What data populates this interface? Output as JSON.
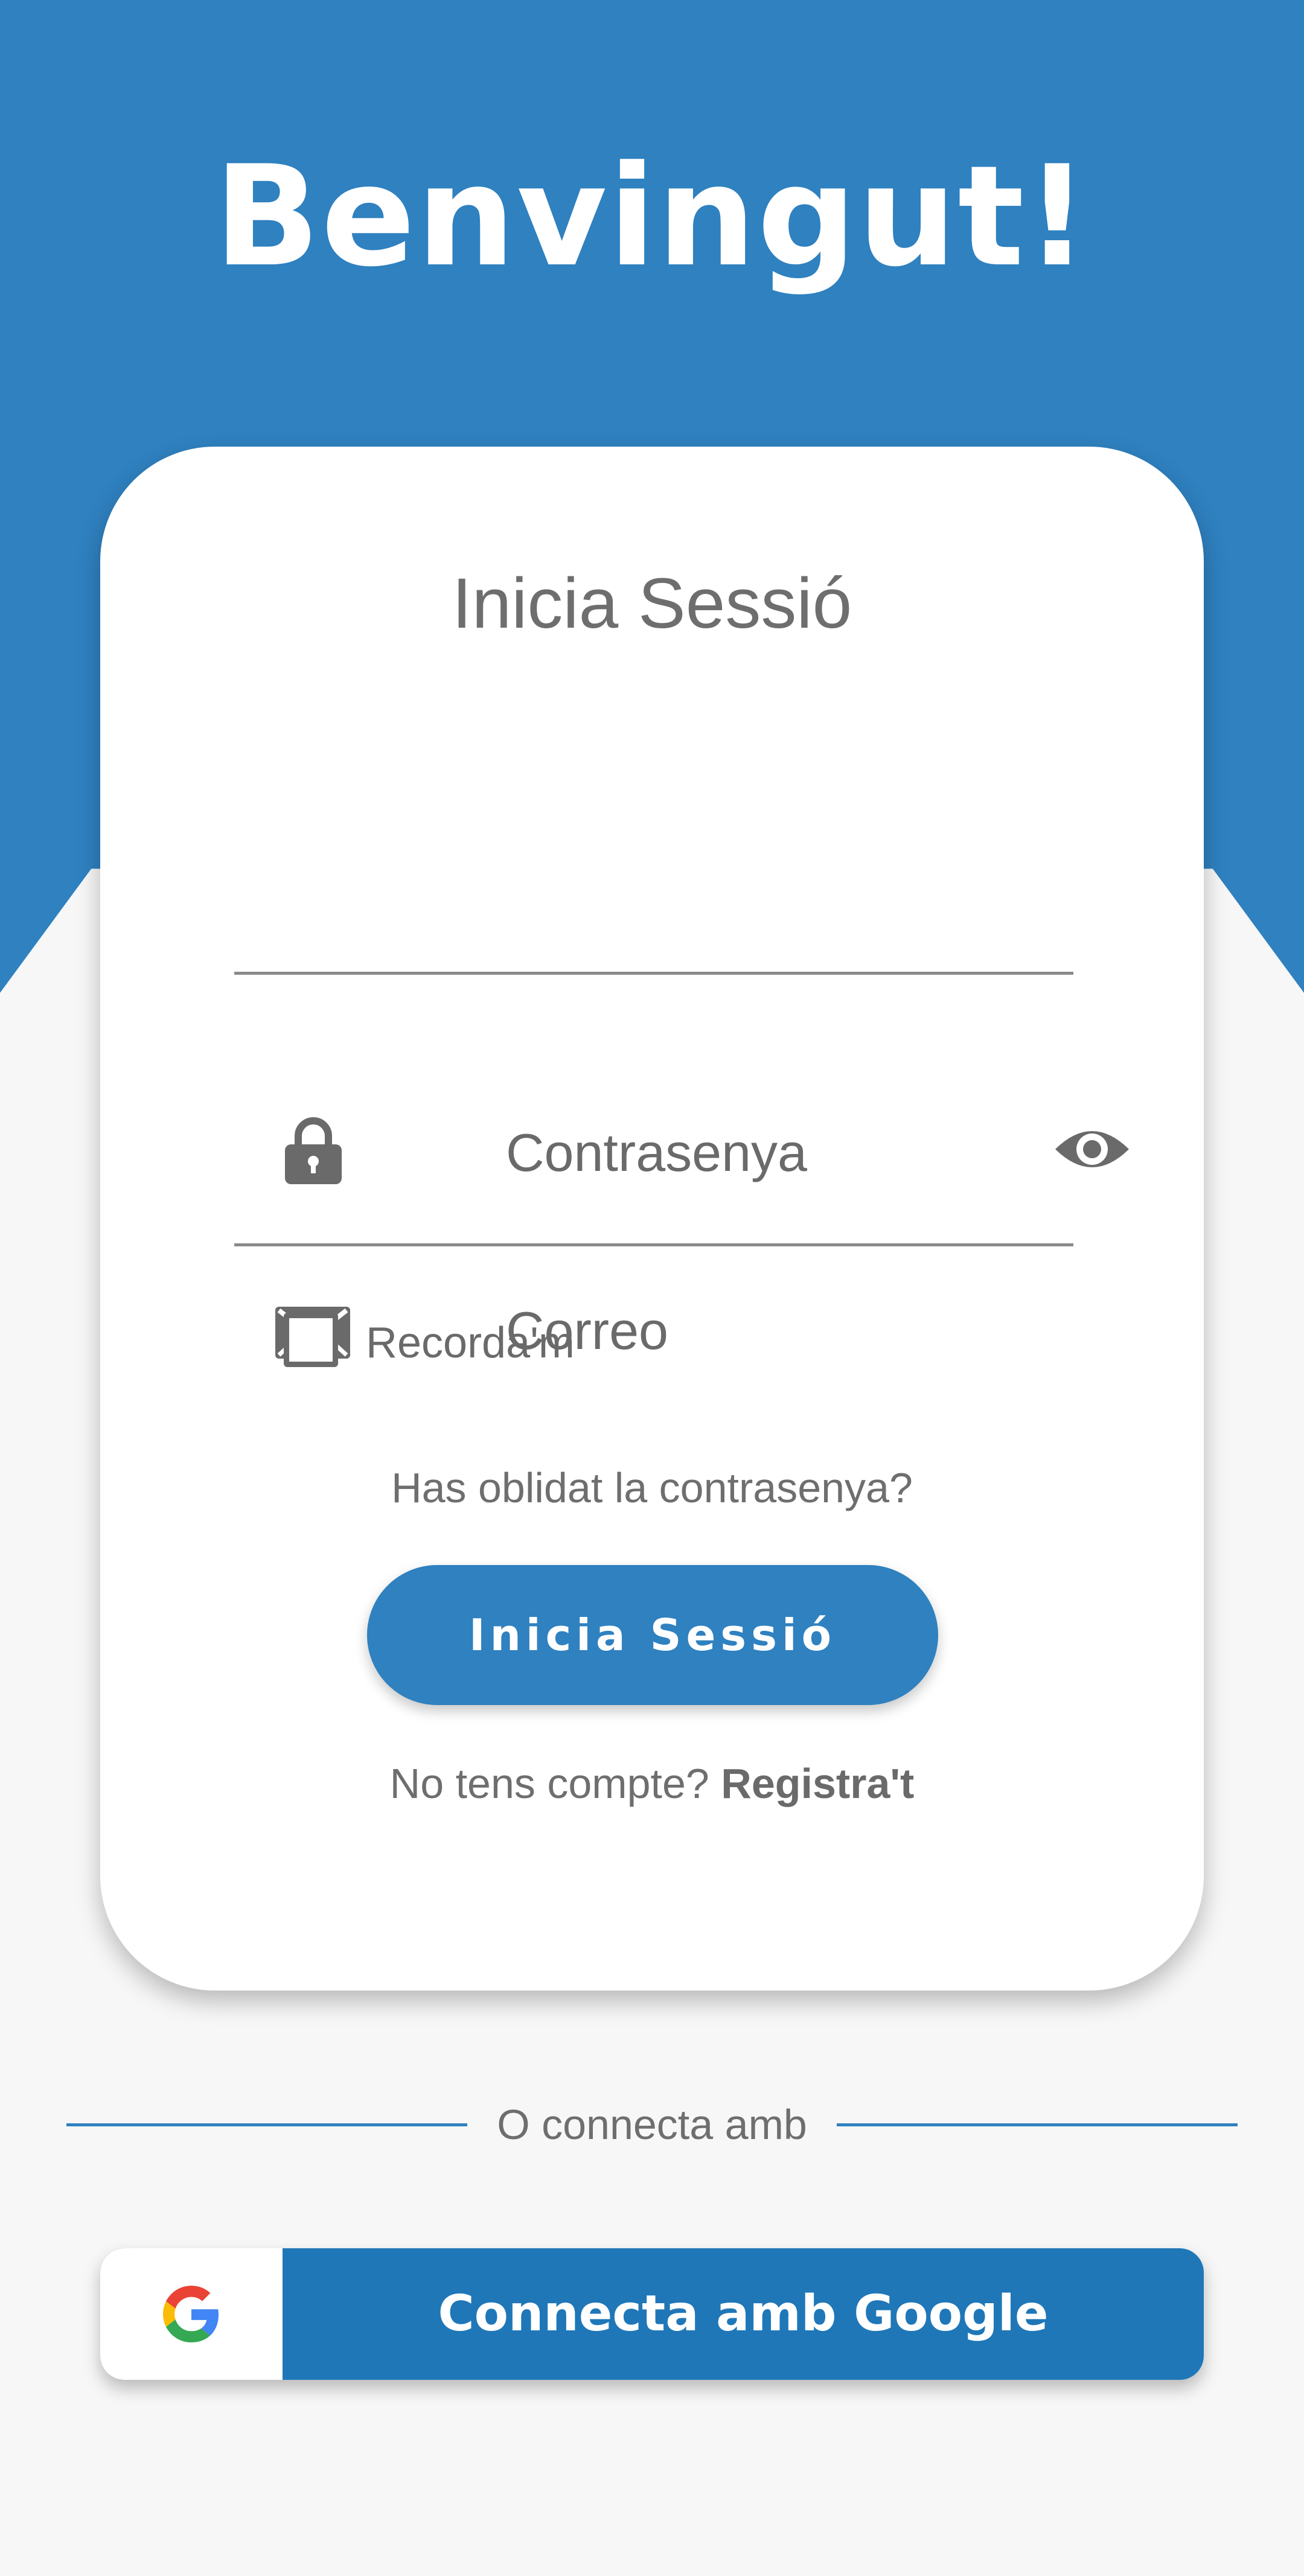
{
  "header": {
    "welcome_title": "Benvingut!"
  },
  "login_card": {
    "title": "Inicia Sessió",
    "email_field": {
      "placeholder": "Correo",
      "icon": "envelope-icon"
    },
    "password_field": {
      "placeholder": "Contrasenya",
      "icon": "lock-icon",
      "toggle_icon": "eye-icon"
    },
    "remember_me": {
      "label": "Recorda'm",
      "checked": false
    },
    "forgot_password": "Has oblidat la contrasenya?",
    "login_button": "Inicia Sessió",
    "signup_prompt": "No tens compte?",
    "signup_link": "Registra't"
  },
  "social": {
    "divider_text": "O connecta amb",
    "google_button": "Connecta amb Google",
    "google_icon": "google-g-icon"
  },
  "colors": {
    "primary": "#2f81c0",
    "google_button": "#1f77b8",
    "background": "#f7f7f7",
    "text_gray": "#6e6e6e"
  }
}
